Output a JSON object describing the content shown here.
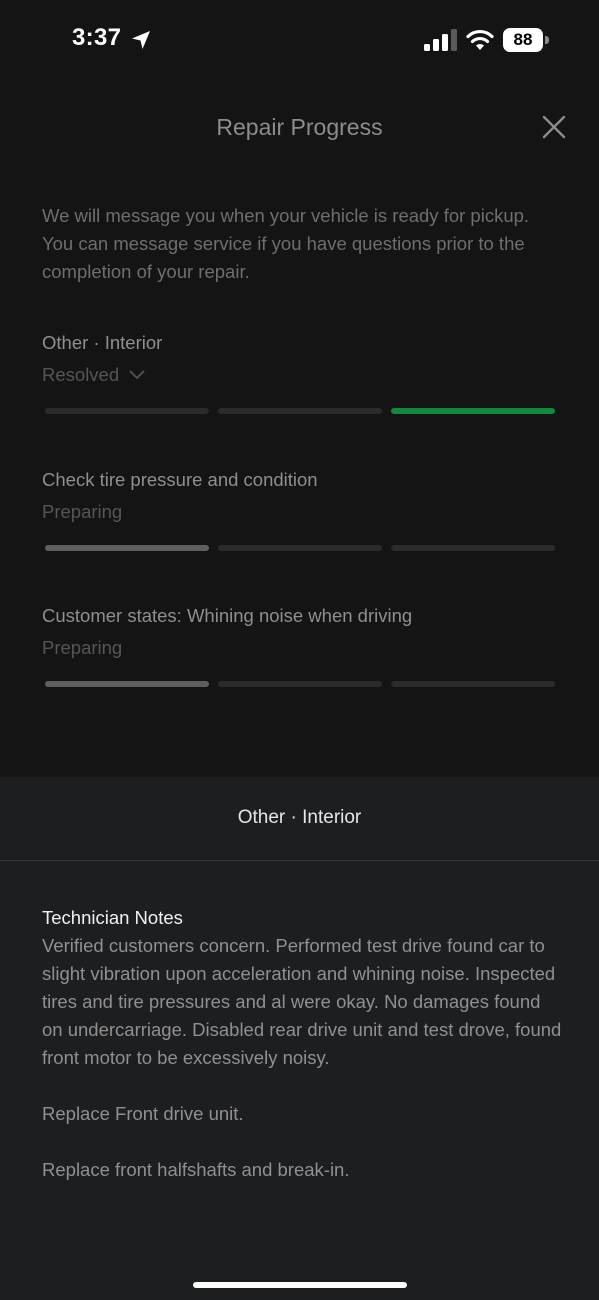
{
  "status_bar": {
    "time": "3:37",
    "battery": "88",
    "icons": [
      "location-arrow-icon",
      "cellular-signal-icon",
      "wifi-icon",
      "battery-icon"
    ]
  },
  "header": {
    "title": "Repair Progress",
    "close_icon": "close-icon"
  },
  "intro": "We will message you when your vehicle is ready for pickup. You can message service if you have questions prior to the completion of your repair.",
  "repair_items": [
    {
      "title": "Other · Interior",
      "status": "Resolved",
      "expandable": true,
      "progress_segments": 3,
      "filled_segments": 3,
      "active_color": "#0f8a3c"
    },
    {
      "title": "Check tire pressure and condition",
      "status": "Preparing",
      "progress_segments": 3,
      "filled_segments": 1,
      "active_color": "#5f5f5f"
    },
    {
      "title": "Customer states: Whining noise when driving",
      "status": "Preparing",
      "progress_segments": 3,
      "filled_segments": 1,
      "active_color": "#5f5f5f"
    }
  ],
  "sheet": {
    "title": "Other · Interior",
    "notes_heading": "Technician Notes",
    "notes_paragraphs": [
      "Verified customers concern. Performed test drive found car to slight vibration upon acceleration and whining noise. Inspected tires and tire pressures and al were okay. No damages found on undercarriage. Disabled rear drive unit and test drove, found front motor to be excessively noisy.",
      "Replace Front drive unit.",
      "Replace front halfshafts and break-in."
    ]
  },
  "colors": {
    "background": "#141414",
    "sheet_background": "#1d1e20",
    "resolved_green": "#0f8a3c",
    "inactive_track": "#2b2b2b"
  }
}
